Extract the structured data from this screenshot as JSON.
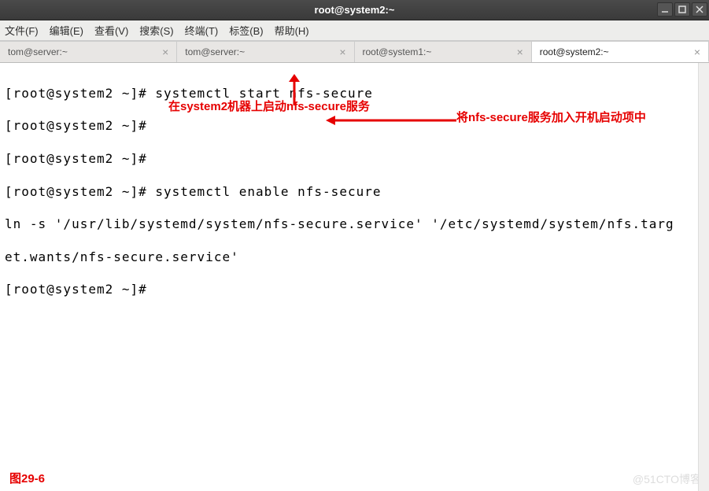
{
  "window": {
    "title": "root@system2:~"
  },
  "menu": {
    "file": "文件(F)",
    "edit": "编辑(E)",
    "view": "查看(V)",
    "search": "搜索(S)",
    "terminal": "终端(T)",
    "tabs": "标签(B)",
    "help": "帮助(H)"
  },
  "tabs": [
    {
      "label": "tom@server:~"
    },
    {
      "label": "tom@server:~"
    },
    {
      "label": "root@system1:~"
    },
    {
      "label": "root@system2:~"
    }
  ],
  "term": {
    "l1": "[root@system2 ~]# systemctl start nfs-secure",
    "l2": "[root@system2 ~]# ",
    "l3": "[root@system2 ~]# ",
    "l4": "[root@system2 ~]# systemctl enable nfs-secure",
    "l5": "ln -s '/usr/lib/systemd/system/nfs-secure.service' '/etc/systemd/system/nfs.targ",
    "l6": "et.wants/nfs-secure.service'",
    "l7": "[root@system2 ~]# "
  },
  "annotations": {
    "a1": "在system2机器上启动nfs-secure服务",
    "a2": "将nfs-secure服务加入开机启动项中",
    "fig": "图29-6"
  },
  "watermark": "@51CTO博客",
  "icons": {
    "close": "×"
  }
}
